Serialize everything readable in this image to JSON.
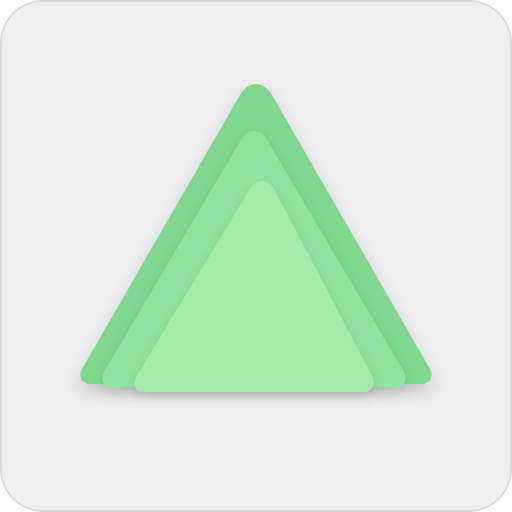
{
  "icon": {
    "name": "layered-triangle-app-icon",
    "colors": {
      "background": "#efefef",
      "border": "#d9d9d9",
      "layer_back": "#7fd88f",
      "layer_middle": "#92e3a1",
      "layer_front": "#a5ecab",
      "shadow": "#000000"
    }
  }
}
